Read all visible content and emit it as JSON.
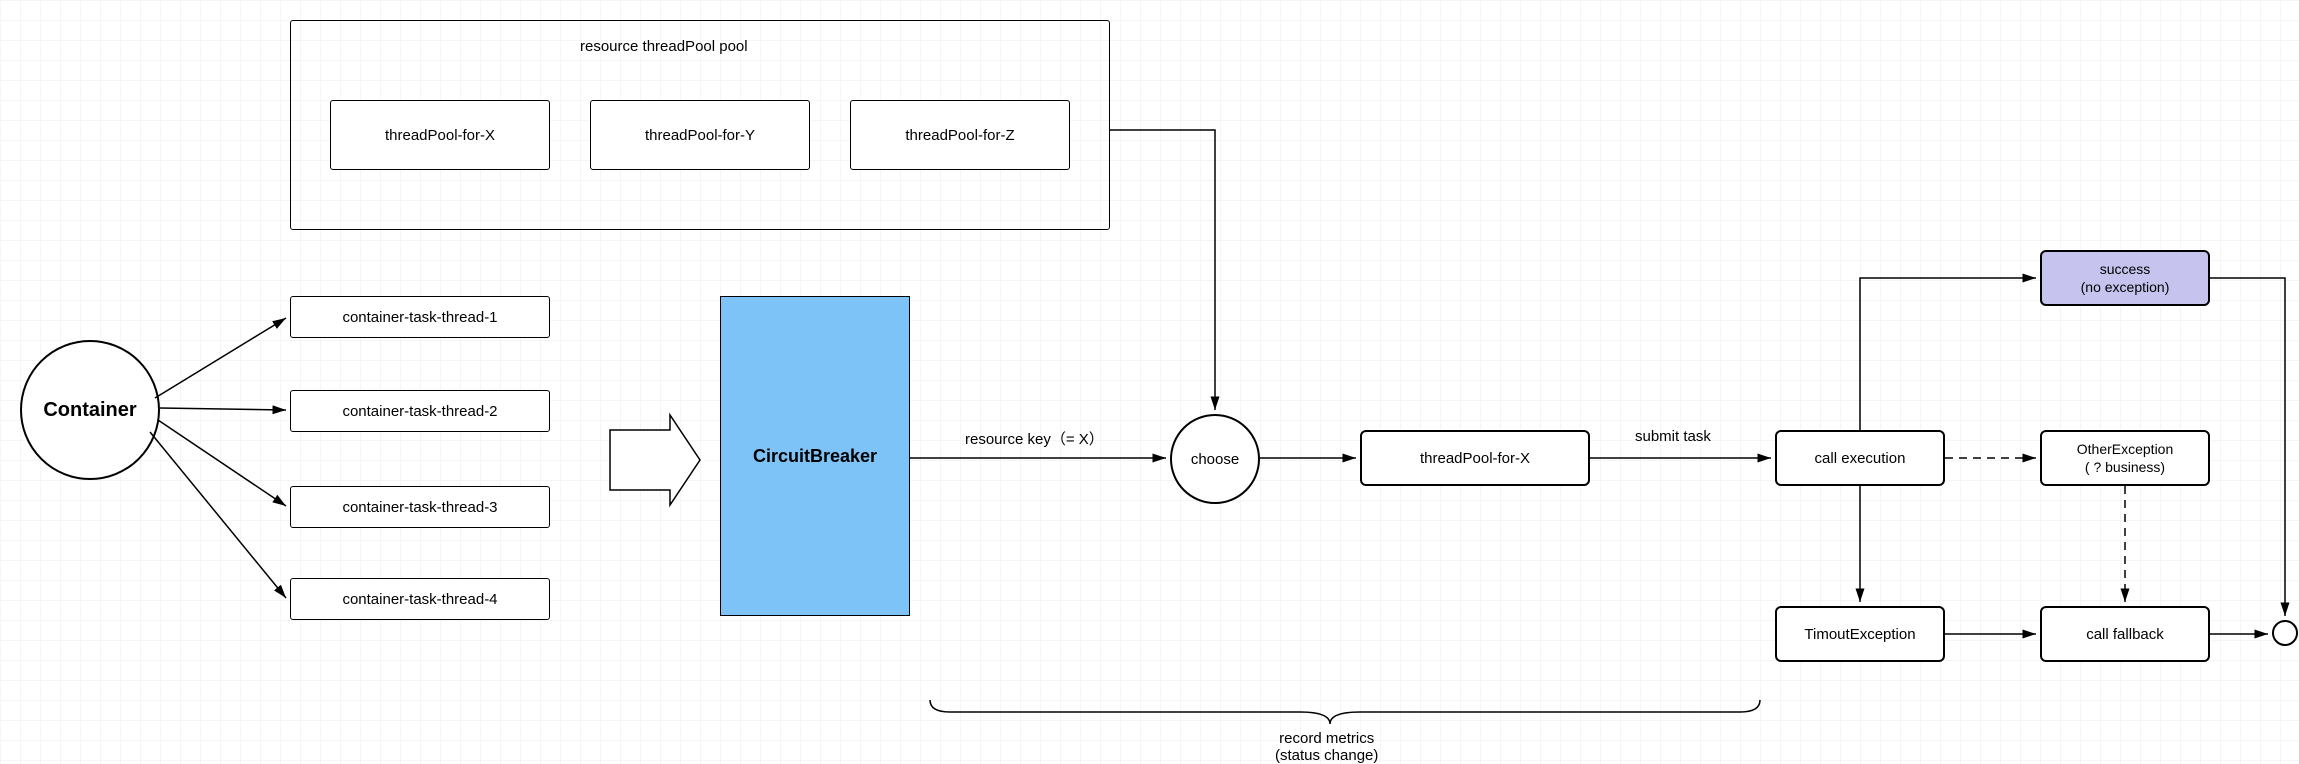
{
  "container": {
    "label": "Container"
  },
  "tasks": [
    {
      "label": "container-task-thread-1"
    },
    {
      "label": "container-task-thread-2"
    },
    {
      "label": "container-task-thread-3"
    },
    {
      "label": "container-task-thread-4"
    }
  ],
  "pool": {
    "title": "resource threadPool pool",
    "items": [
      {
        "label": "threadPool-for-X"
      },
      {
        "label": "threadPool-for-Y"
      },
      {
        "label": "threadPool-for-Z"
      }
    ]
  },
  "circuitBreaker": {
    "label": "CircuitBreaker"
  },
  "edgeLabels": {
    "resourceKey": "resource key（= X）",
    "submitTask": "submit task",
    "recordMetrics1": "record metrics",
    "recordMetrics2": "(status change)"
  },
  "nodes": {
    "choose": "choose",
    "threadPoolForX": "threadPool-for-X",
    "callExecution": "call execution",
    "success1": "success",
    "success2": "(no exception)",
    "otherEx1": "OtherException",
    "otherEx2": "( ? business)",
    "timeoutEx": "TimoutException",
    "callFallback": "call fallback"
  }
}
